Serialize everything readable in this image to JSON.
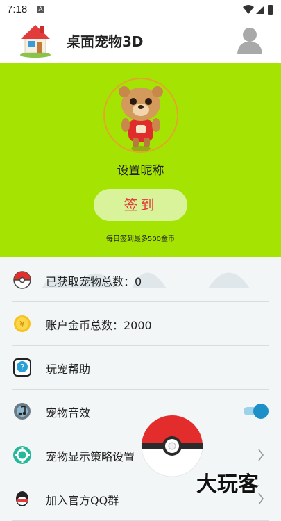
{
  "status": {
    "time": "7:18",
    "notif_letter": "A"
  },
  "app": {
    "title": "桌面宠物3D"
  },
  "hero": {
    "nickname": "设置昵称",
    "signin_label": "签到",
    "hint": "每日签到最多500金币"
  },
  "menu": {
    "items": [
      {
        "label": "已获取宠物总数：0",
        "icon": "pokeball-icon"
      },
      {
        "label": "账户金币总数：2000",
        "icon": "coin-icon"
      },
      {
        "label": "玩宠帮助",
        "icon": "help-icon"
      },
      {
        "label": "宠物音效",
        "icon": "music-icon",
        "toggle_on": true
      },
      {
        "label": "宠物显示策略设置",
        "icon": "gear-icon"
      },
      {
        "label": "加入官方QQ群",
        "icon": "qq-icon"
      }
    ]
  },
  "watermark": "大玩客",
  "colors": {
    "hero_bg": "#a5e303",
    "signin_text": "#e23b3b",
    "toggle": "#1e90c8"
  }
}
